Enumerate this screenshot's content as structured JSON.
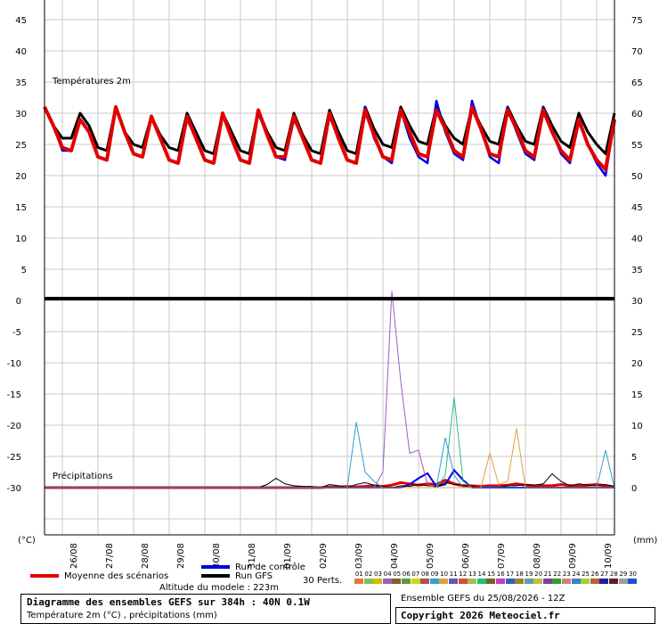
{
  "header_labels": {
    "temp_panel": "Températures 2m",
    "precip_panel": "Précipitations",
    "left_unit": "(°C)",
    "right_unit": "(mm)"
  },
  "legend": {
    "mean": "Moyenne des scénarios",
    "control": "Run de contrôle",
    "gfs": "Run GFS",
    "perts": "30 Perts.",
    "altitude": "Altitude du modele : 223m",
    "mean_color": "#e00000",
    "control_color": "#0000e0",
    "gfs_color": "#000000"
  },
  "footer": {
    "title": "Diagramme des ensembles GEFS sur 384h : 40N 0.1W",
    "subtitle": "Température 2m (°C) , précipitations (mm)",
    "run": "Ensemble GEFS du 25/08/2026 - 12Z",
    "copyright": "Copyright 2026 Meteociel.fr"
  },
  "perturbations": {
    "labels": [
      "01",
      "02",
      "03",
      "04",
      "05",
      "06",
      "07",
      "08",
      "09",
      "10",
      "11",
      "12",
      "13",
      "14",
      "15",
      "16",
      "17",
      "18",
      "19",
      "20",
      "21",
      "22",
      "23",
      "24",
      "25",
      "26",
      "27",
      "28",
      "29",
      "30"
    ],
    "colors": [
      "#e07a3c",
      "#7fbf5a",
      "#d6b800",
      "#9b5fc0",
      "#8a5a2b",
      "#5a9e3a",
      "#d4d41c",
      "#b05050",
      "#30a0d0",
      "#e0a040",
      "#5a5ab0",
      "#d05030",
      "#a0c050",
      "#20c080",
      "#806020",
      "#c040c0",
      "#3060c0",
      "#a08030",
      "#60a0a0",
      "#c0c040",
      "#8040a0",
      "#30a030",
      "#d08080",
      "#4080c0",
      "#a0d040",
      "#c06030",
      "#2020a0",
      "#602020",
      "#a0a0a0",
      "#2050d0"
    ]
  },
  "chart_data": [
    {
      "type": "line",
      "title": "Températures 2m",
      "ylabel": "(°C)",
      "x_ticks": [
        "26/08",
        "27/08",
        "28/08",
        "29/08",
        "30/08",
        "31/08",
        "01/09",
        "02/09",
        "03/09",
        "04/09",
        "05/09",
        "06/09",
        "07/09",
        "08/09",
        "09/09",
        "10/09"
      ],
      "ylim": [
        0,
        45
      ],
      "yticks": [
        0,
        5,
        10,
        15,
        20,
        25,
        30,
        35,
        40,
        45
      ],
      "right_yticks": [
        30,
        35,
        40,
        45,
        50,
        55,
        60,
        65,
        70,
        75
      ],
      "x_hours": [
        0,
        6,
        12,
        18,
        24,
        30,
        36,
        42,
        48,
        54,
        60,
        66,
        72,
        78,
        84,
        90,
        96,
        102,
        108,
        114,
        120,
        126,
        132,
        138,
        144,
        150,
        156,
        162,
        168,
        174,
        180,
        186,
        192,
        198,
        204,
        210,
        216,
        222,
        228,
        234,
        240,
        246,
        252,
        258,
        264,
        270,
        276,
        282,
        288,
        294,
        300,
        306,
        312,
        318,
        324,
        330,
        336,
        342,
        348,
        354,
        360,
        366,
        372,
        378,
        384
      ],
      "series": [
        {
          "name": "Moyenne des scénarios",
          "values": [
            31,
            28,
            24.5,
            24,
            29,
            27,
            23,
            22.5,
            31,
            27,
            23.5,
            23,
            29.5,
            26,
            22.5,
            22,
            29.5,
            26,
            22.5,
            22,
            30,
            26,
            22.5,
            22,
            30.5,
            26.5,
            23,
            23,
            29.5,
            26,
            22.5,
            22,
            30,
            26,
            22.5,
            22,
            30.5,
            26.5,
            23,
            22.5,
            30.5,
            27,
            23.5,
            23,
            30.5,
            27.5,
            24,
            23,
            31,
            27.5,
            23.5,
            23,
            30.5,
            27.5,
            24,
            23,
            30.5,
            27,
            24,
            22.5,
            29,
            25,
            22.5,
            21,
            29
          ]
        },
        {
          "name": "Run de contrôle",
          "values": [
            31,
            28,
            24,
            24,
            29,
            27,
            23,
            22.5,
            31,
            27,
            23.5,
            23,
            29.5,
            26,
            22.5,
            22,
            29,
            26,
            22.5,
            22,
            30,
            26,
            22.5,
            22,
            30,
            26.5,
            23,
            22.5,
            29,
            26,
            22.5,
            22,
            29.5,
            26,
            22.5,
            22,
            31,
            26,
            23,
            22,
            30.5,
            26,
            23,
            22,
            32,
            27,
            23.5,
            22.5,
            32,
            27.5,
            23,
            22,
            31,
            27,
            23.5,
            22.5,
            31,
            27,
            23.5,
            22,
            28.5,
            25,
            22,
            20,
            29
          ]
        },
        {
          "name": "Run GFS",
          "values": [
            31,
            28,
            26,
            26,
            30,
            28,
            24.5,
            24,
            31,
            27,
            25,
            24.5,
            29.5,
            26.5,
            24.5,
            24,
            30,
            27,
            24,
            23.5,
            30,
            27,
            24,
            23.5,
            30.5,
            27,
            24.5,
            24,
            30,
            26.5,
            24,
            23.5,
            30.5,
            27,
            24,
            23.5,
            31,
            27.5,
            25,
            24.5,
            31,
            28,
            25.5,
            25,
            31,
            28,
            26,
            25,
            31,
            28,
            25.5,
            25,
            31,
            28,
            25.5,
            25,
            31,
            28,
            25.5,
            24.5,
            30,
            27,
            25,
            23.5,
            30
          ]
        }
      ]
    },
    {
      "type": "line",
      "title": "Précipitations",
      "ylabel": "(mm)",
      "right_yticks": [
        0,
        5,
        10,
        15,
        20,
        25,
        30
      ],
      "left_yticks": [
        -30,
        -25,
        -20,
        -15,
        -10,
        -5,
        0
      ],
      "ylim": [
        0,
        30
      ],
      "x_hours": [
        0,
        6,
        12,
        18,
        24,
        30,
        36,
        42,
        48,
        54,
        60,
        66,
        72,
        78,
        84,
        90,
        96,
        102,
        108,
        114,
        120,
        126,
        132,
        138,
        144,
        150,
        156,
        162,
        168,
        174,
        180,
        186,
        192,
        198,
        204,
        210,
        216,
        222,
        228,
        234,
        240,
        246,
        252,
        258,
        264,
        270,
        276,
        282,
        288,
        294,
        300,
        306,
        312,
        318,
        324,
        330,
        336,
        342,
        348,
        354,
        360,
        366,
        372,
        378,
        384
      ],
      "series": [
        {
          "name": "Moyenne des scénarios",
          "values": [
            0,
            0,
            0,
            0,
            0,
            0,
            0,
            0,
            0,
            0,
            0,
            0,
            0,
            0,
            0,
            0,
            0,
            0,
            0,
            0,
            0,
            0,
            0,
            0,
            0,
            0,
            0,
            0,
            0,
            0,
            0,
            0,
            0.1,
            0.1,
            0.2,
            0.1,
            0.2,
            0.3,
            0.2,
            0.4,
            0.8,
            0.6,
            0.4,
            0.6,
            0.5,
            1.2,
            0.6,
            0.3,
            0.3,
            0.2,
            0.3,
            0.3,
            0.4,
            0.6,
            0.4,
            0.3,
            0.3,
            0.3,
            0.5,
            0.3,
            0.3,
            0.4,
            0.5,
            0.3,
            0.1
          ]
        },
        {
          "name": "Run de contrôle",
          "values": [
            0,
            0,
            0,
            0,
            0,
            0,
            0,
            0,
            0,
            0,
            0,
            0,
            0,
            0,
            0,
            0,
            0,
            0,
            0,
            0,
            0,
            0,
            0,
            0,
            0,
            0,
            0,
            0,
            0,
            0,
            0,
            0,
            0,
            0,
            0,
            0,
            0,
            0,
            0,
            0,
            0,
            0.5,
            1.5,
            2.3,
            0.2,
            0.5,
            2.8,
            1.2,
            0,
            0,
            0,
            0,
            0,
            0,
            0,
            0,
            0,
            0,
            0,
            0,
            0,
            0,
            0,
            0,
            0
          ]
        },
        {
          "name": "Run GFS",
          "values": [
            0,
            0,
            0,
            0,
            0,
            0,
            0,
            0,
            0,
            0,
            0,
            0,
            0,
            0,
            0,
            0,
            0,
            0,
            0,
            0,
            0,
            0,
            0,
            0,
            0,
            0.5,
            1.5,
            0.6,
            0.3,
            0.2,
            0.2,
            0,
            0.5,
            0.3,
            0,
            0.5,
            0.8,
            0.4,
            0.2,
            0,
            0.3,
            0.2,
            0.5,
            0.3,
            0.2,
            0.8,
            0.5,
            0.4,
            0.2,
            0,
            0,
            0,
            0.3,
            0.3,
            0.5,
            0.4,
            0.6,
            2.2,
            1.0,
            0.3,
            0.6,
            0.4,
            0.3,
            0.5,
            0.2
          ]
        },
        {
          "name": "04",
          "values": [
            0,
            0,
            0,
            0,
            0,
            0,
            0,
            0,
            0,
            0,
            0,
            0,
            0,
            0,
            0,
            0,
            0,
            0,
            0,
            0,
            0,
            0,
            0,
            0,
            0,
            0,
            0,
            0,
            0,
            0,
            0,
            0,
            0,
            0,
            0,
            0,
            0,
            0,
            2.5,
            31.5,
            17,
            5.5,
            6,
            0.5,
            0,
            0,
            0,
            0,
            0,
            0,
            0,
            0,
            0,
            0,
            0,
            0,
            0,
            0,
            0,
            0,
            0,
            0,
            0,
            0,
            0
          ]
        },
        {
          "name": "14",
          "values": [
            0,
            0,
            0,
            0,
            0,
            0,
            0,
            0,
            0,
            0,
            0,
            0,
            0,
            0,
            0,
            0,
            0,
            0,
            0,
            0,
            0,
            0,
            0,
            0,
            0,
            0,
            0,
            0,
            0,
            0,
            0,
            0,
            0,
            0,
            0,
            0,
            0,
            0,
            0,
            0,
            0,
            0,
            0,
            0,
            0,
            2.0,
            14.5,
            1.0,
            0,
            0,
            0,
            0,
            0,
            0,
            0,
            0,
            0,
            0,
            0,
            0,
            0,
            0,
            0,
            0,
            0
          ]
        },
        {
          "name": "09",
          "values": [
            0,
            0,
            0,
            0,
            0,
            0,
            0,
            0,
            0,
            0,
            0,
            0,
            0,
            0,
            0,
            0,
            0,
            0,
            0,
            0,
            0,
            0,
            0,
            0,
            0,
            0,
            0,
            0,
            0,
            0,
            0,
            0,
            0,
            0,
            0,
            10.5,
            2.5,
            1.0,
            0,
            0,
            0,
            0,
            0,
            0,
            0,
            8.0,
            2.0,
            0,
            0,
            0,
            0,
            0,
            0,
            0,
            0,
            0,
            0,
            0,
            0,
            0,
            0,
            0,
            0,
            6.0,
            0
          ]
        },
        {
          "name": "10",
          "values": [
            0,
            0,
            0,
            0,
            0,
            0,
            0,
            0,
            0,
            0,
            0,
            0,
            0,
            0,
            0,
            0,
            0,
            0,
            0,
            0,
            0,
            0,
            0,
            0,
            0,
            0,
            0,
            0,
            0,
            0,
            0,
            0,
            0,
            0,
            0,
            0,
            0,
            0,
            0,
            0,
            0,
            0,
            0,
            0,
            0,
            0,
            0,
            0,
            0,
            0,
            5.5,
            0.5,
            1.0,
            9.5,
            0,
            0,
            0,
            0,
            0,
            0,
            0,
            0,
            0,
            0,
            0
          ]
        }
      ]
    }
  ]
}
